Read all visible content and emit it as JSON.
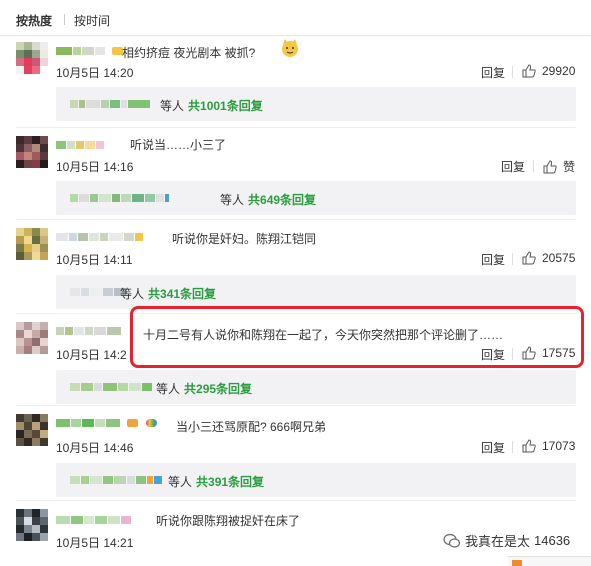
{
  "sort": {
    "hot_label": "按热度",
    "time_label": "按时间"
  },
  "comments": [
    {
      "text": "相约挤痘 夜光剧本 被抓?",
      "time": "10月5日 14:20",
      "reply": "回复",
      "likes": "29920",
      "sub": {
        "suffix": "等人",
        "count": "共1001条回复"
      }
    },
    {
      "text": "听说当……小三了",
      "time": "10月5日 14:16",
      "reply": "回复",
      "likes": "赞",
      "sub": {
        "suffix": "等人",
        "count": "共649条回复"
      }
    },
    {
      "text": "听说你是奸妇。陈翔江铠同",
      "time": "10月5日 14:11",
      "reply": "回复",
      "likes": "20575",
      "sub": {
        "suffix": "等人",
        "count": "共341条回复"
      }
    },
    {
      "text": "十月二号有人说你和陈翔在一起了，今天你突然把那个评论删了……",
      "time": "10月5日 14:2",
      "reply": "回复",
      "likes": "17575",
      "sub": {
        "suffix": "等人",
        "count": "共295条回复"
      }
    },
    {
      "text": "当小三还骂原配? 666啊兄弟",
      "time": "10月5日 14:46",
      "reply": "回复",
      "likes": "17073",
      "sub": {
        "suffix": "等人",
        "count": "共391条回复"
      }
    },
    {
      "text": "听说你跟陈翔被捉奸在床了",
      "time": "10月5日 14:21",
      "reply": "",
      "likes": ""
    }
  ],
  "watermark": {
    "text": "我真在是太 ",
    "num": "14636"
  },
  "colors": {
    "accent_green": "#2a9d3e",
    "highlight_red": "#e8222c"
  }
}
